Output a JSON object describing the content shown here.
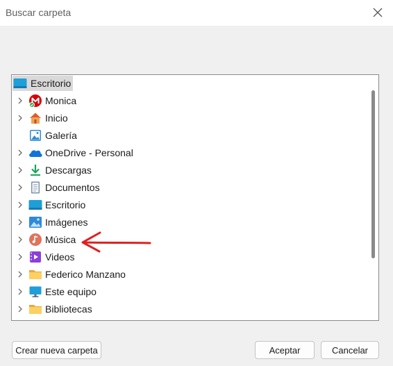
{
  "window": {
    "title": "Buscar carpeta"
  },
  "tree": {
    "root": {
      "label": "Escritorio",
      "icon": "desktop-icon"
    },
    "items": [
      {
        "label": "Monica",
        "icon": "mega-icon",
        "expandable": true
      },
      {
        "label": "Inicio",
        "icon": "home-icon",
        "expandable": true
      },
      {
        "label": "Galería",
        "icon": "gallery-icon",
        "expandable": false
      },
      {
        "label": "OneDrive - Personal",
        "icon": "onedrive-icon",
        "expandable": true
      },
      {
        "label": "Descargas",
        "icon": "downloads-icon",
        "expandable": true
      },
      {
        "label": "Documentos",
        "icon": "documents-icon",
        "expandable": true
      },
      {
        "label": "Escritorio",
        "icon": "desktop-icon",
        "expandable": true
      },
      {
        "label": "Imágenes",
        "icon": "pictures-icon",
        "expandable": true
      },
      {
        "label": "Música",
        "icon": "music-icon",
        "expandable": true
      },
      {
        "label": "Videos",
        "icon": "videos-icon",
        "expandable": true
      },
      {
        "label": "Federico Manzano",
        "icon": "folder-icon",
        "expandable": true
      },
      {
        "label": "Este equipo",
        "icon": "computer-icon",
        "expandable": true
      },
      {
        "label": "Bibliotecas",
        "icon": "folder-icon",
        "expandable": true
      }
    ]
  },
  "buttons": {
    "new_folder": "Crear nueva carpeta",
    "accept": "Aceptar",
    "cancel": "Cancelar"
  },
  "annotation": {
    "color": "#e02020",
    "points_to": "Música"
  }
}
